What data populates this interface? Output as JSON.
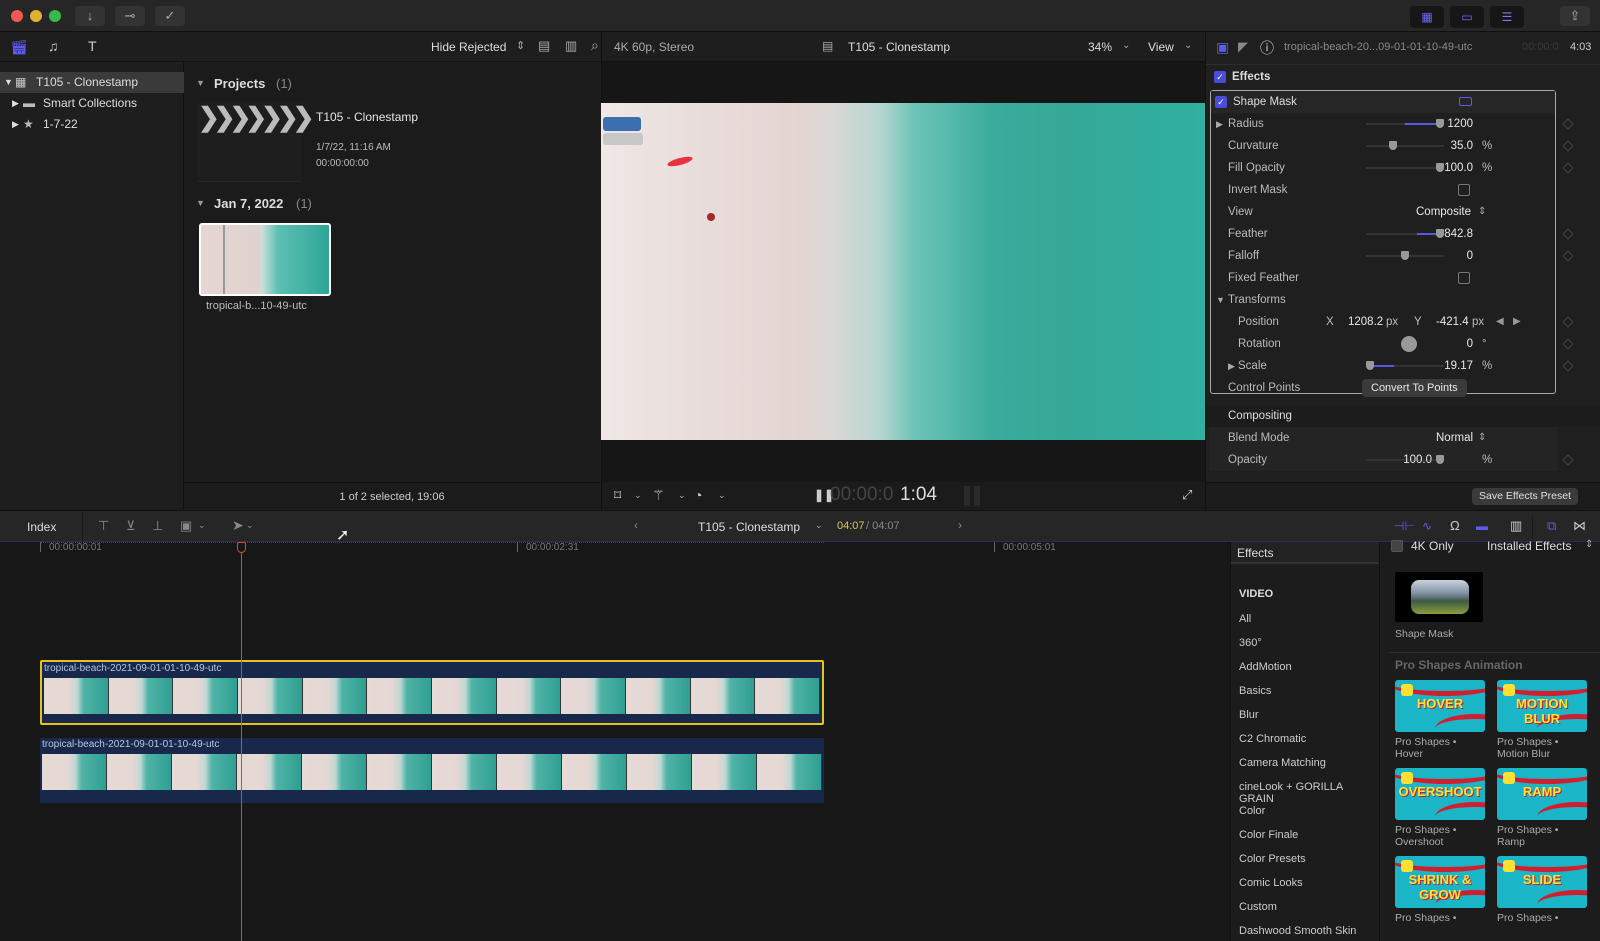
{
  "colors": {
    "accent": "#4b4bd9",
    "playhead": "#e0453a",
    "selection": "#e8c21c",
    "timecode_current": "#d4c65a"
  },
  "toolbar": {
    "left_icons": [
      "import-arrow-icon",
      "keyword-key-icon",
      "background-task-check-icon"
    ],
    "right_icons": [
      "browser-layout-icon",
      "timeline-layout-icon",
      "inspector-layout-icon",
      "share-icon"
    ]
  },
  "library": {
    "filter_label": "Hide Rejected",
    "items": [
      {
        "label": "T105 - Clonestamp",
        "icon": "library-icon",
        "selected": true
      },
      {
        "label": "Smart Collections",
        "icon": "folder-icon",
        "selected": false
      },
      {
        "label": "1-7-22",
        "icon": "event-star-icon",
        "selected": false
      }
    ]
  },
  "browser": {
    "projects_header": "Projects",
    "projects_count": "(1)",
    "project": {
      "name": "T105 - Clonestamp",
      "date": "1/7/22, 11:16 AM",
      "duration": "00:00:00:00"
    },
    "event_header": "Jan 7, 2022",
    "event_count": "(1)",
    "clip_name": "tropical-b...10-49-utc",
    "footer": "1 of 2 selected, 19:06"
  },
  "viewer": {
    "format": "4K 60p, Stereo",
    "title": "T105 - Clonestamp",
    "zoom": "34%",
    "view_label": "View",
    "timecode_dim": "00:00:0",
    "timecode_bright": "1:04"
  },
  "inspector": {
    "clip_name": "tropical-beach-20...09-01-01-10-49-utc",
    "timecode_dim": "00:00:0",
    "timecode_bright": "4:03",
    "effects_label": "Effects",
    "effect_name": "Shape Mask",
    "params": {
      "radius": {
        "label": "Radius",
        "value": "1200",
        "fraction": 0.95
      },
      "curvature": {
        "label": "Curvature",
        "value": "35.0",
        "unit": "%",
        "fraction": 0.35
      },
      "fill_opacity": {
        "label": "Fill Opacity",
        "value": "100.0",
        "unit": "%",
        "fraction": 1.0
      },
      "invert_mask": {
        "label": "Invert Mask",
        "checked": false
      },
      "view": {
        "label": "View",
        "value": "Composite"
      },
      "feather": {
        "label": "Feather",
        "value": "842.8",
        "fraction": 0.95
      },
      "falloff": {
        "label": "Falloff",
        "value": "0",
        "fraction": 0.5
      },
      "fixed_feather": {
        "label": "Fixed Feather",
        "checked": false
      },
      "transforms_label": "Transforms",
      "position": {
        "label": "Position",
        "x_label": "X",
        "x": "1208.2",
        "y_label": "Y",
        "y": "-421.4",
        "unit": "px"
      },
      "rotation": {
        "label": "Rotation",
        "value": "0",
        "unit": "°"
      },
      "scale": {
        "label": "Scale",
        "value": "19.17",
        "unit": "%",
        "fraction": 0.05
      },
      "control_points": {
        "label": "Control Points",
        "button": "Convert To Points"
      }
    },
    "compositing": {
      "label": "Compositing",
      "blend_mode": {
        "label": "Blend Mode",
        "value": "Normal"
      },
      "opacity": {
        "label": "Opacity",
        "value": "100.0",
        "unit": "%",
        "fraction": 1.0
      }
    },
    "save_preset": "Save Effects Preset"
  },
  "timeline": {
    "index_label": "Index",
    "project_name": "T105 - Clonestamp",
    "position_current": "04:07",
    "position_total": "/ 04:07",
    "ruler": [
      "00:00:00:01",
      "00:00:02:31",
      "00:00:05:01"
    ],
    "clips": [
      {
        "name": "tropical-beach-2021-09-01-01-10-49-utc",
        "selected": true
      },
      {
        "name": "tropical-beach-2021-09-01-01-10-49-utc",
        "selected": false
      }
    ]
  },
  "effects_browser": {
    "title": "Effects",
    "four_k_only": "4K Only",
    "installed": "Installed Effects",
    "section": "VIDEO",
    "categories": [
      "All",
      "360°",
      "AddMotion",
      "Basics",
      "Blur",
      "C2 Chromatic",
      "Camera Matching",
      "cineLook + GORILLA GRAIN",
      "Color",
      "Color Finale",
      "Color Presets",
      "Comic Looks",
      "Custom",
      "Dashwood Smooth Skin"
    ],
    "shape_mask_label": "Shape Mask",
    "group_title": "Pro Shapes Animation",
    "items": [
      {
        "thumb_text": "HOVER",
        "label1": "Pro Shapes •",
        "label2": "Hover"
      },
      {
        "thumb_text": "MOTION BLUR",
        "label1": "Pro Shapes •",
        "label2": "Motion Blur"
      },
      {
        "thumb_text": "OVERSHOOT",
        "label1": "Pro Shapes •",
        "label2": "Overshoot"
      },
      {
        "thumb_text": "RAMP",
        "label1": "Pro Shapes •",
        "label2": "Ramp"
      },
      {
        "thumb_text": "SHRINK & GROW",
        "label1": "Pro Shapes •",
        "label2": ""
      },
      {
        "thumb_text": "SLIDE",
        "label1": "Pro Shapes •",
        "label2": ""
      }
    ]
  }
}
